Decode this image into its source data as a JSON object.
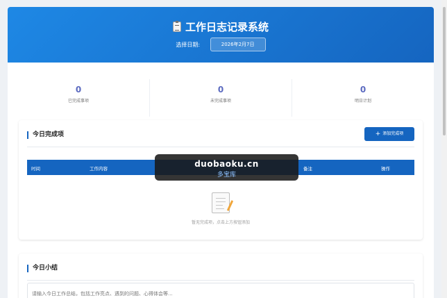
{
  "app": {
    "title": "工作日志记录系统",
    "title_icon": "clipboard-icon"
  },
  "date_picker": {
    "label": "选择日期:",
    "value": "2026年2月7日"
  },
  "stats": [
    {
      "value": "0",
      "label": "已完成事项"
    },
    {
      "value": "0",
      "label": "未完成事项"
    },
    {
      "value": "0",
      "label": "明日计划"
    }
  ],
  "completed_section": {
    "title": "今日完成项",
    "add_button_label": "添加完成项",
    "add_button_icon": "plus-icon",
    "columns": [
      "时间",
      "工作内容",
      "备注",
      "操作"
    ],
    "empty_text": "暂无完成项，点击上方按钮添加",
    "empty_icon": "memo-icon"
  },
  "summary_section": {
    "title": "今日小结",
    "placeholder": "请输入今日工作总结，包括工作亮点、遇到的问题、心得体会等..."
  },
  "watermark": {
    "line1": "duobaoku.cn",
    "line2": "多宝库"
  },
  "colors": {
    "primary": "#1565c0",
    "header_gradient_start": "#1e88e5",
    "stat_number": "#5c6bc0"
  }
}
